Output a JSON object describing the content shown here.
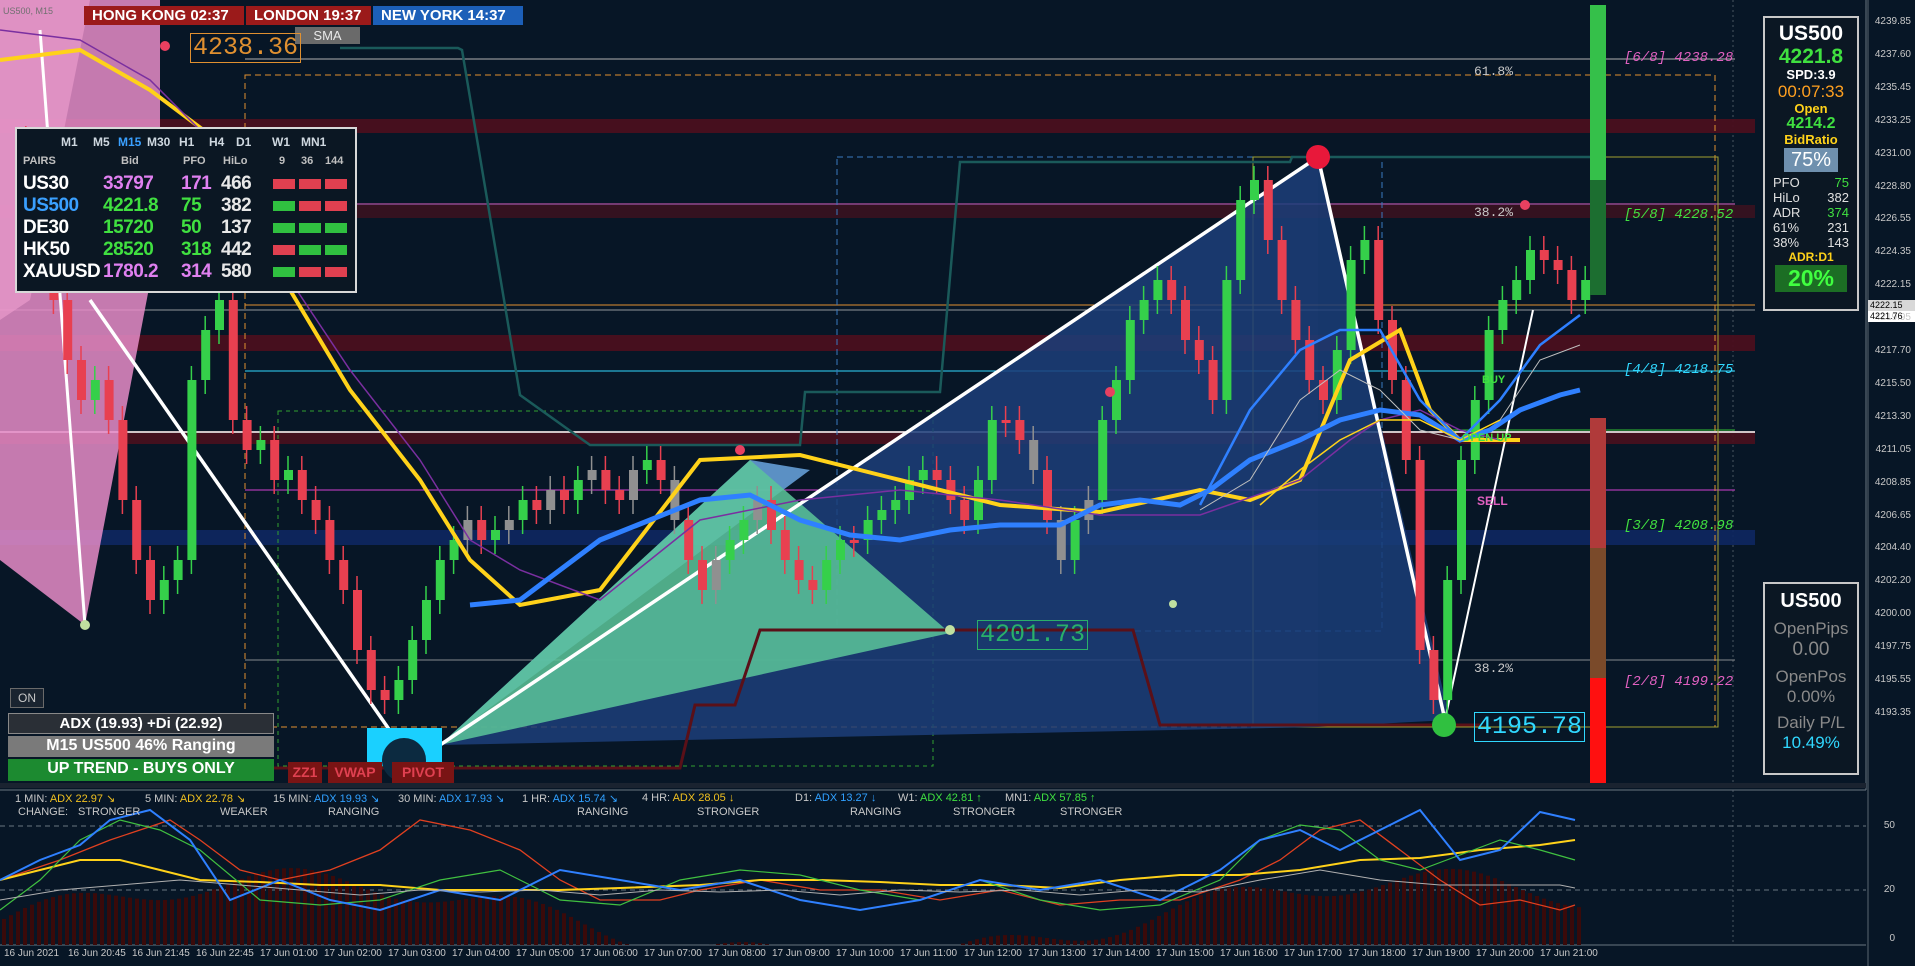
{
  "sessions": [
    {
      "label": "HONG KONG 02:37",
      "color": "#9b1a1a"
    },
    {
      "label": "LONDON  19:37",
      "color": "#9b1a1a"
    },
    {
      "label": "NEW YORK 14:37",
      "color": "#1c5fb8"
    }
  ],
  "chart_header": "US500, M15",
  "sma_button": "SMA",
  "price_labels": {
    "top": "4238.36",
    "mid": "4201.73",
    "low": "4195.78"
  },
  "fib_labels": [
    "61.8%",
    "38.2%",
    "38.2%"
  ],
  "murrey": [
    {
      "label": "[6/8]  4238.28",
      "color": "#e060c0"
    },
    {
      "label": "[5/8]  4228.52",
      "color": "#40e040"
    },
    {
      "label": "[4/8]  4218.75",
      "color": "#30d8ff"
    },
    {
      "label": "[3/8]  4208.98",
      "color": "#40e040"
    },
    {
      "label": "[2/8]  4199.22",
      "color": "#e060c0"
    }
  ],
  "signals": {
    "buy": "BUY",
    "open_up": "OPEN UP",
    "sell": "SELL"
  },
  "pairs_table": {
    "timeframes": [
      "M1",
      "M5",
      "M15",
      "M30",
      "H1",
      "H4",
      "D1",
      "W1",
      "MN1"
    ],
    "active_tf": "M15",
    "headers": [
      "PAIRS",
      "Bid",
      "PFO",
      "HiLo",
      "9",
      "36",
      "144"
    ],
    "rows": [
      {
        "pair": "US30",
        "bid": "33797",
        "pfo": "171",
        "hilo": "466",
        "pair_color": "#ffffff",
        "bid_color": "#e080f0",
        "pfo_color": "#e080f0",
        "bars": [
          "#e04050",
          "#e04050",
          "#e04050"
        ]
      },
      {
        "pair": "US500",
        "bid": "4221.8",
        "pfo": "75",
        "hilo": "382",
        "pair_color": "#3aa0ff",
        "bid_color": "#40e040",
        "pfo_color": "#40e040",
        "bars": [
          "#30c040",
          "#e04050",
          "#e04050"
        ]
      },
      {
        "pair": "DE30",
        "bid": "15720",
        "pfo": "50",
        "hilo": "137",
        "pair_color": "#ffffff",
        "bid_color": "#40e040",
        "pfo_color": "#40e040",
        "bars": [
          "#30c040",
          "#30c040",
          "#30c040"
        ]
      },
      {
        "pair": "HK50",
        "bid": "28520",
        "pfo": "318",
        "hilo": "442",
        "pair_color": "#ffffff",
        "bid_color": "#40e040",
        "pfo_color": "#40e040",
        "bars": [
          "#e04050",
          "#30c040",
          "#30c040"
        ]
      },
      {
        "pair": "XAUUSD",
        "bid": "1780.2",
        "pfo": "314",
        "hilo": "580",
        "pair_color": "#ffffff",
        "bid_color": "#e080f0",
        "pfo_color": "#e080f0",
        "bars": [
          "#30c040",
          "#e04050",
          "#e04050"
        ]
      }
    ]
  },
  "info_panel": {
    "symbol": "US500",
    "price": "4221.8",
    "spread": "SPD:3.9",
    "timer": "00:07:33",
    "open_label": "Open",
    "open_value": "4214.2",
    "bidratio_label": "BidRatio",
    "bidratio_value": "75%",
    "stats": [
      {
        "k": "PFO",
        "v": "75",
        "vc": "#40e040"
      },
      {
        "k": "HiLo",
        "v": "382",
        "vc": "#e0e0e0"
      },
      {
        "k": "ADR",
        "v": "374",
        "vc": "#40e040"
      },
      {
        "k": "61%",
        "v": "231",
        "vc": "#e0e0e0"
      },
      {
        "k": "38%",
        "v": "143",
        "vc": "#e0e0e0"
      }
    ],
    "adr_d1_label": "ADR:D1",
    "adr_d1_value": "20%"
  },
  "pos_panel": {
    "symbol": "US500",
    "open_pips_label": "OpenPips",
    "open_pips": "0.00",
    "open_pos_label": "OpenPos",
    "open_pos": "0.00%",
    "daily_pl_label": "Daily P/L",
    "daily_pl": "10.49%"
  },
  "left_buttons": {
    "on": "ON",
    "adx": "ADX (19.93)   +Di (22.92)",
    "ranging": "M15 US500 46% Ranging",
    "trend": "UP TREND - BUYS ONLY",
    "zz1": "ZZ1",
    "vwap": "VWAP",
    "pivot": "PIVOT"
  },
  "adx_panel": {
    "change_label": "CHANGE:",
    "items": [
      {
        "tf": "1 MIN:",
        "adx": "ADX 22.97",
        "arrow": "↘",
        "status": "STRONGER",
        "color": "#f0c020"
      },
      {
        "tf": "5 MIN:",
        "adx": "ADX 22.78",
        "arrow": "↘",
        "status": "WEAKER",
        "color": "#f0c020"
      },
      {
        "tf": "15 MIN:",
        "adx": "ADX 19.93",
        "arrow": "↘",
        "status": "RANGING",
        "color": "#30a0ff"
      },
      {
        "tf": "30 MIN:",
        "adx": "ADX 17.93",
        "arrow": "↘",
        "status": "",
        "color": "#30a0ff"
      },
      {
        "tf": "1 HR:",
        "adx": "ADX 15.74",
        "arrow": "↘",
        "status": "RANGING",
        "color": "#30a0ff"
      },
      {
        "tf": "4 HR:",
        "adx": "ADX 28.05",
        "arrow": "↓",
        "status": "STRONGER",
        "color": "#f0c020"
      },
      {
        "tf": "D1:",
        "adx": "ADX 13.27",
        "arrow": "↓",
        "status": "RANGING",
        "color": "#30a0ff"
      },
      {
        "tf": "W1:",
        "adx": "ADX 42.81",
        "arrow": "↑",
        "status": "STRONGER",
        "color": "#40e040"
      },
      {
        "tf": "MN1:",
        "adx": "ADX 57.85",
        "arrow": "↑",
        "status": "STRONGER",
        "color": "#40e040"
      }
    ]
  },
  "price_axis": [
    "4239.85",
    "4237.60",
    "4235.45",
    "4233.25",
    "4231.00",
    "4228.80",
    "4226.55",
    "4224.35",
    "4222.15",
    "4219.95",
    "4217.70",
    "4215.50",
    "4213.30",
    "4211.05",
    "4208.85",
    "4206.65",
    "4204.40",
    "4202.20",
    "4200.00",
    "4197.75",
    "4195.55",
    "4193.35"
  ],
  "price_axis_tags": {
    "bid": "4222.15",
    "last": "4221.76"
  },
  "indicator_axis": [
    "50",
    "20",
    "0"
  ],
  "time_axis": [
    "16 Jun 2021",
    "16 Jun 20:45",
    "16 Jun 21:45",
    "16 Jun 22:45",
    "17 Jun 01:00",
    "17 Jun 02:00",
    "17 Jun 03:00",
    "17 Jun 04:00",
    "17 Jun 05:00",
    "17 Jun 06:00",
    "17 Jun 07:00",
    "17 Jun 08:00",
    "17 Jun 09:00",
    "17 Jun 10:00",
    "17 Jun 11:00",
    "17 Jun 12:00",
    "17 Jun 13:00",
    "17 Jun 14:00",
    "17 Jun 15:00",
    "17 Jun 16:00",
    "17 Jun 17:00",
    "17 Jun 18:00",
    "17 Jun 19:00",
    "17 Jun 20:00",
    "17 Jun 21:00"
  ],
  "colors": {
    "bull": "#35d04a",
    "bear": "#e84050",
    "neutral": "#909090",
    "fast_ma": "#2f80ff",
    "slow_ma": "#ffd21a",
    "wave": "#e878b8"
  }
}
